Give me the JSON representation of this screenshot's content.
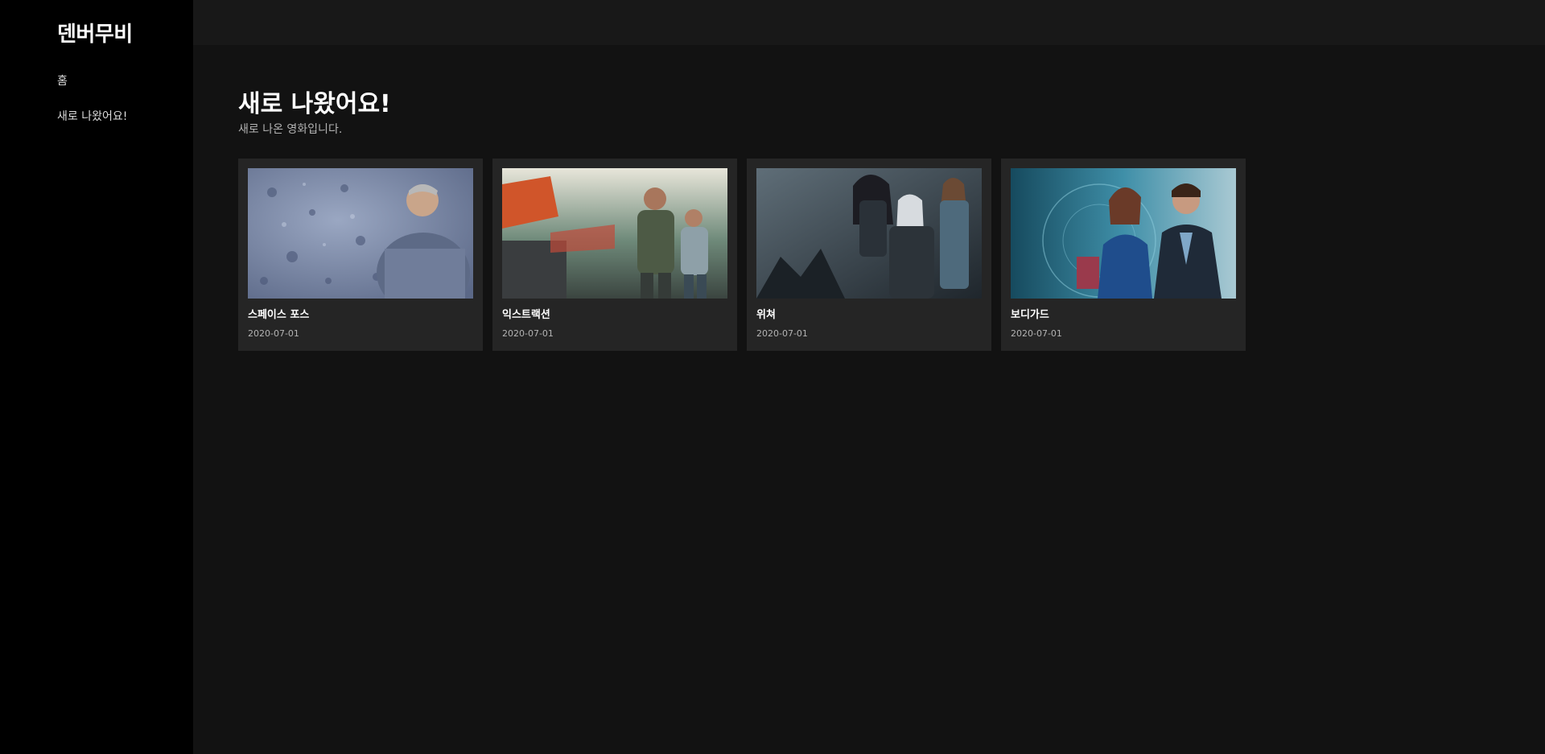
{
  "sidebar": {
    "logo": "덴버무비",
    "items": [
      {
        "label": "홈"
      },
      {
        "label": "새로 나왔어요!"
      }
    ]
  },
  "main": {
    "title": "새로 나왔어요!",
    "subtitle": "새로 나온 영화입니다."
  },
  "movies": [
    {
      "title": "스페이스 포스",
      "date": "2020-07-01",
      "palette": "#7a8aa8"
    },
    {
      "title": "익스트랙션",
      "date": "2020-07-01",
      "palette": "#5e6b5a"
    },
    {
      "title": "위쳐",
      "date": "2020-07-01",
      "palette": "#3e4a55"
    },
    {
      "title": "보디가드",
      "date": "2020-07-01",
      "palette": "#2f6f86"
    }
  ]
}
